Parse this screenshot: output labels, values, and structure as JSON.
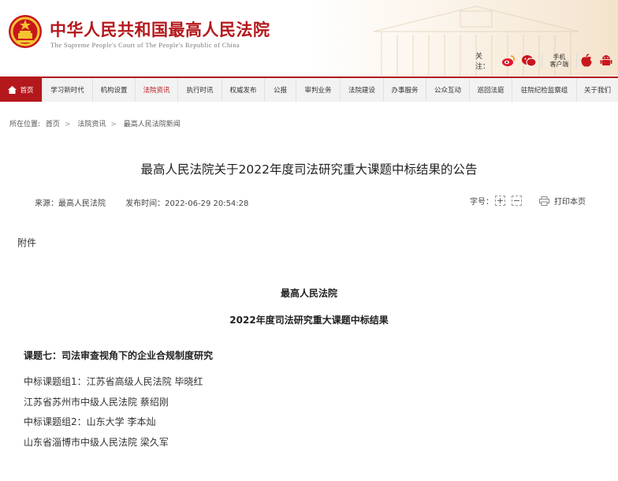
{
  "header": {
    "site_title": "中华人民共和国最高人民法院",
    "site_subtitle": "The Supreme People's Court of The People's Republic of China",
    "follow_label": "关注：",
    "mobile_label_line1": "手机",
    "mobile_label_line2": "客户端",
    "brand_red": "#b5181c"
  },
  "nav": {
    "items": [
      {
        "label": "首页"
      },
      {
        "label": "学习新时代"
      },
      {
        "label": "机构设置"
      },
      {
        "label": "法院资讯"
      },
      {
        "label": "执行时讯"
      },
      {
        "label": "权威发布"
      },
      {
        "label": "公报"
      },
      {
        "label": "审判业务"
      },
      {
        "label": "法院建设"
      },
      {
        "label": "办事服务"
      },
      {
        "label": "公众互动"
      },
      {
        "label": "巡回法庭"
      },
      {
        "label": "驻院纪检监察组"
      },
      {
        "label": "关于我们"
      }
    ]
  },
  "breadcrumb": {
    "prefix": "所在位置:",
    "items": [
      "首页",
      "法院资讯",
      "最高人民法院新闻"
    ]
  },
  "article": {
    "title": "最高人民法院关于2022年度司法研究重大课题中标结果的公告",
    "source": "来源：最高人民法院",
    "published": "发布时间：2022-06-29 20:54:28",
    "font_size_label": "字号：",
    "font_plus": "+",
    "font_minus": "−",
    "print_label": "打印本页",
    "attachment": "附件",
    "court": "最高人民法院",
    "result_title": "2022年度司法研究重大课题中标结果",
    "topic": "课题七：司法审查视角下的企业合规制度研究",
    "lines": [
      "中标课题组1：江苏省高级人民法院 毕晓红",
      "江苏省苏州市中级人民法院  蔡绍刚",
      "中标课题组2：山东大学 李本灿",
      "山东省淄博市中级人民法院  梁久军"
    ]
  }
}
